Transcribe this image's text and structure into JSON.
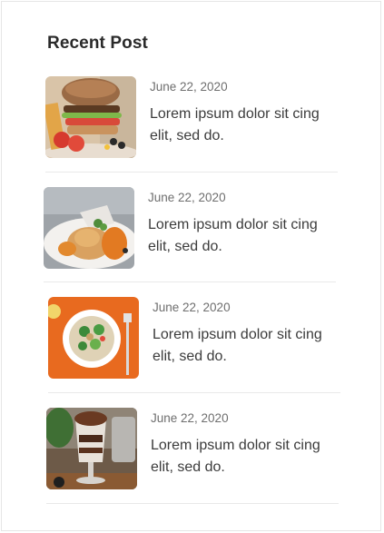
{
  "widget": {
    "title": "Recent Post"
  },
  "posts": [
    {
      "date": "June 22, 2020",
      "text": "Lorem ipsum dolor sit cing elit, sed do.",
      "image": "burger-photo"
    },
    {
      "date": "June 22, 2020",
      "text": "Lorem ipsum dolor sit cing elit, sed do.",
      "image": "plated-dish-photo"
    },
    {
      "date": "June 22, 2020",
      "text": "Lorem ipsum dolor sit cing elit, sed do.",
      "image": "salad-bowl-photo"
    },
    {
      "date": "June 22, 2020",
      "text": "Lorem ipsum dolor sit cing elit, sed do.",
      "image": "dessert-glass-photo"
    }
  ]
}
